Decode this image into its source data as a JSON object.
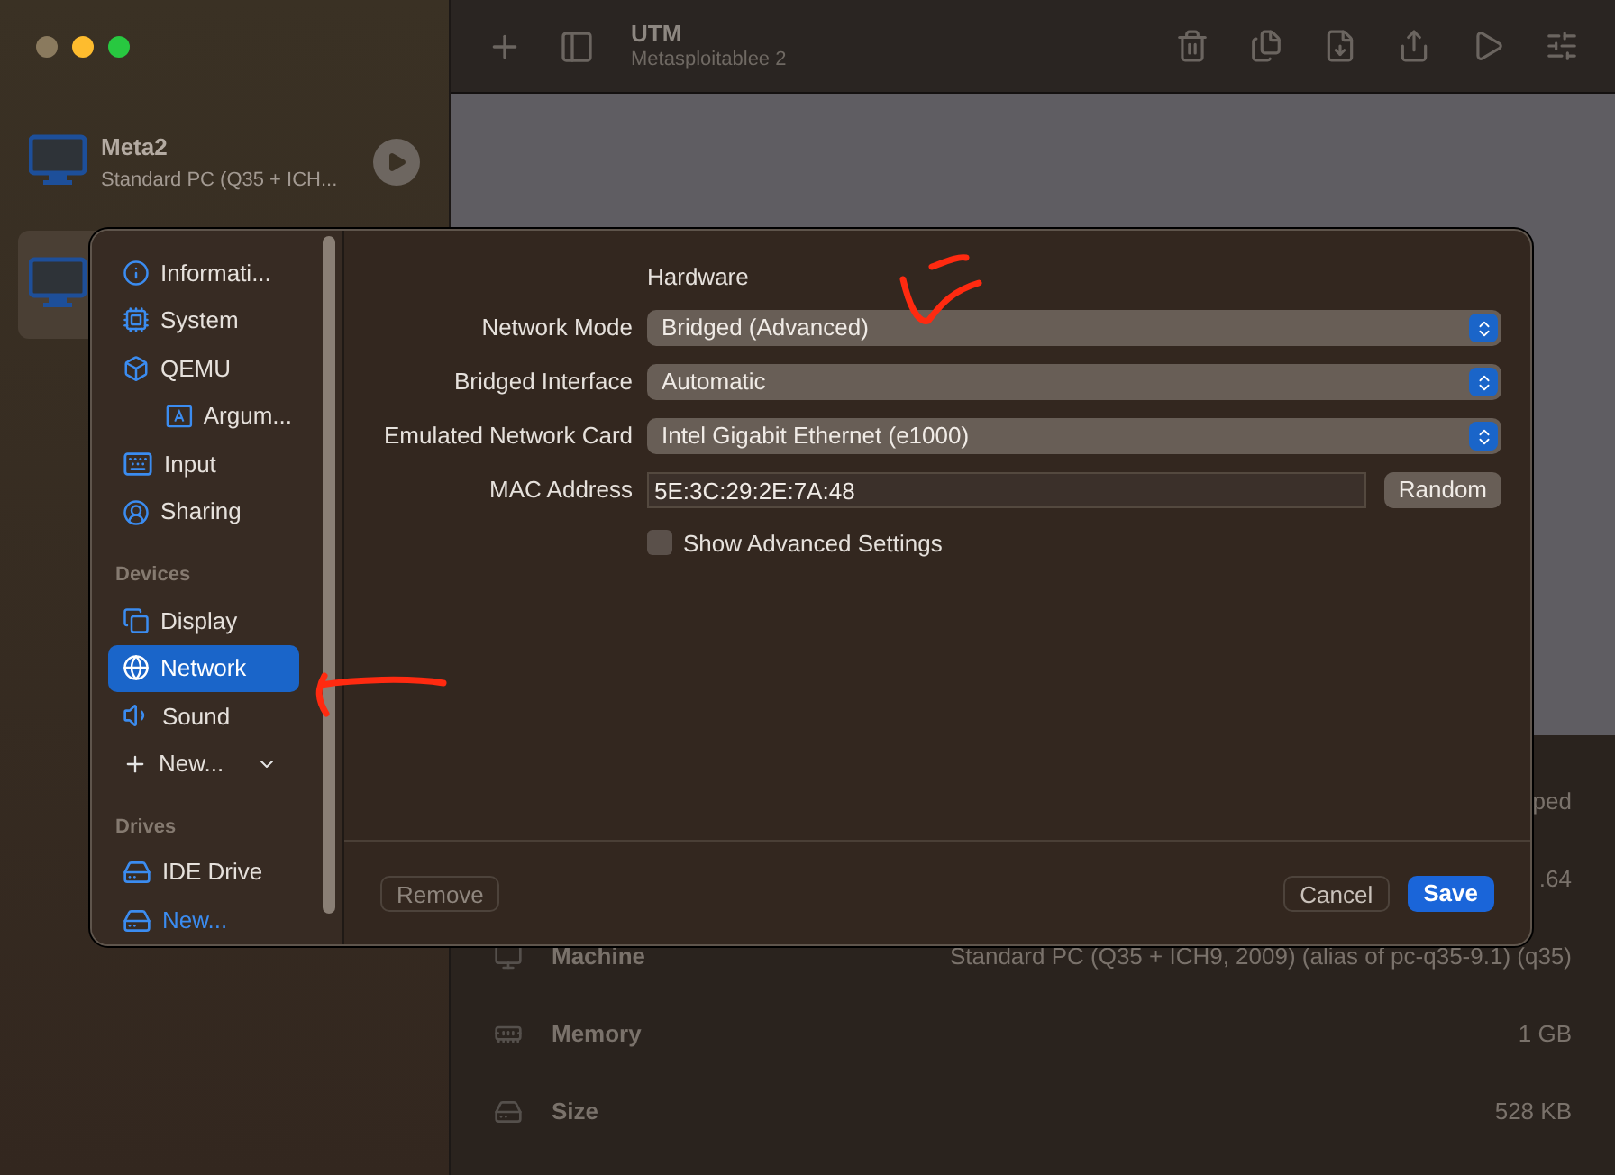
{
  "vm_list": [
    {
      "name": "Meta2",
      "subtitle": "Standard PC (Q35 + ICH...",
      "selected": false
    },
    {
      "selected": true
    }
  ],
  "toolbar": {
    "title": "UTM",
    "subtitle": "Metasploitablee 2"
  },
  "details": [
    {
      "value": "ped"
    },
    {
      "value": ".64"
    },
    {
      "label": "Machine",
      "value": "Standard PC (Q35 + ICH9, 2009) (alias of pc-q35-9.1) (q35)"
    },
    {
      "label": "Memory",
      "value": "1 GB"
    },
    {
      "label": "Size",
      "value": "528 KB"
    }
  ],
  "dialog": {
    "sidebar": [
      {
        "items": [
          {
            "label": "Informati...",
            "selected": false
          },
          {
            "label": "System",
            "selected": false
          },
          {
            "label": "QEMU",
            "selected": false,
            "children": [
              {
                "label": "Argum...",
                "selected": false
              }
            ]
          },
          {
            "label": "Input",
            "selected": false
          },
          {
            "label": "Sharing",
            "selected": false
          }
        ]
      },
      {
        "heading": "Devices",
        "items": [
          {
            "label": "Display",
            "selected": false
          },
          {
            "label": "Network",
            "selected": true
          },
          {
            "label": "Sound",
            "selected": false
          },
          {
            "label": "New...",
            "kind": "add",
            "selected": false
          }
        ]
      },
      {
        "heading": "Drives",
        "items": [
          {
            "label": "IDE Drive",
            "selected": false
          },
          {
            "label": "New...",
            "kind": "add-link",
            "selected": false
          }
        ]
      }
    ],
    "heading": "Hardware",
    "fields": [
      {
        "kind": "select",
        "label": "Network Mode",
        "value": "Bridged (Advanced)"
      },
      {
        "kind": "select",
        "label": "Bridged Interface",
        "value": "Automatic"
      },
      {
        "kind": "select",
        "label": "Emulated Network Card",
        "value": "Intel Gigabit Ethernet (e1000)"
      },
      {
        "kind": "text",
        "label": "MAC Address",
        "value": "5E:3C:29:2E:7A:48",
        "button": "Random"
      }
    ],
    "checkbox": {
      "label": "Show Advanced Settings",
      "checked": false
    },
    "footer": {
      "remove": "Remove",
      "cancel": "Cancel",
      "save": "Save"
    }
  }
}
